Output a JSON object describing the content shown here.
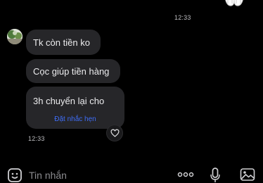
{
  "conversation": {
    "timestamp_top": "12:33",
    "messages": [
      {
        "text": "Tk còn tiền ko"
      },
      {
        "text": "Cọc giúp tiền hàng"
      },
      {
        "text": "3h chuyển lại cho",
        "action": "Đặt nhắc hẹn"
      }
    ],
    "timestamp_bottom": "12:33"
  },
  "composer": {
    "placeholder": "Tin nhắn"
  },
  "icons": {
    "avatar": "avatar",
    "react": "heart-icon",
    "emoji": "smile-icon",
    "more": "more-icon",
    "voice": "microphone-icon",
    "gallery": "image-icon",
    "sticker": "sticker-partial"
  },
  "colors": {
    "background": "#000000",
    "bubble": "#262629",
    "link": "#3f6df5"
  }
}
